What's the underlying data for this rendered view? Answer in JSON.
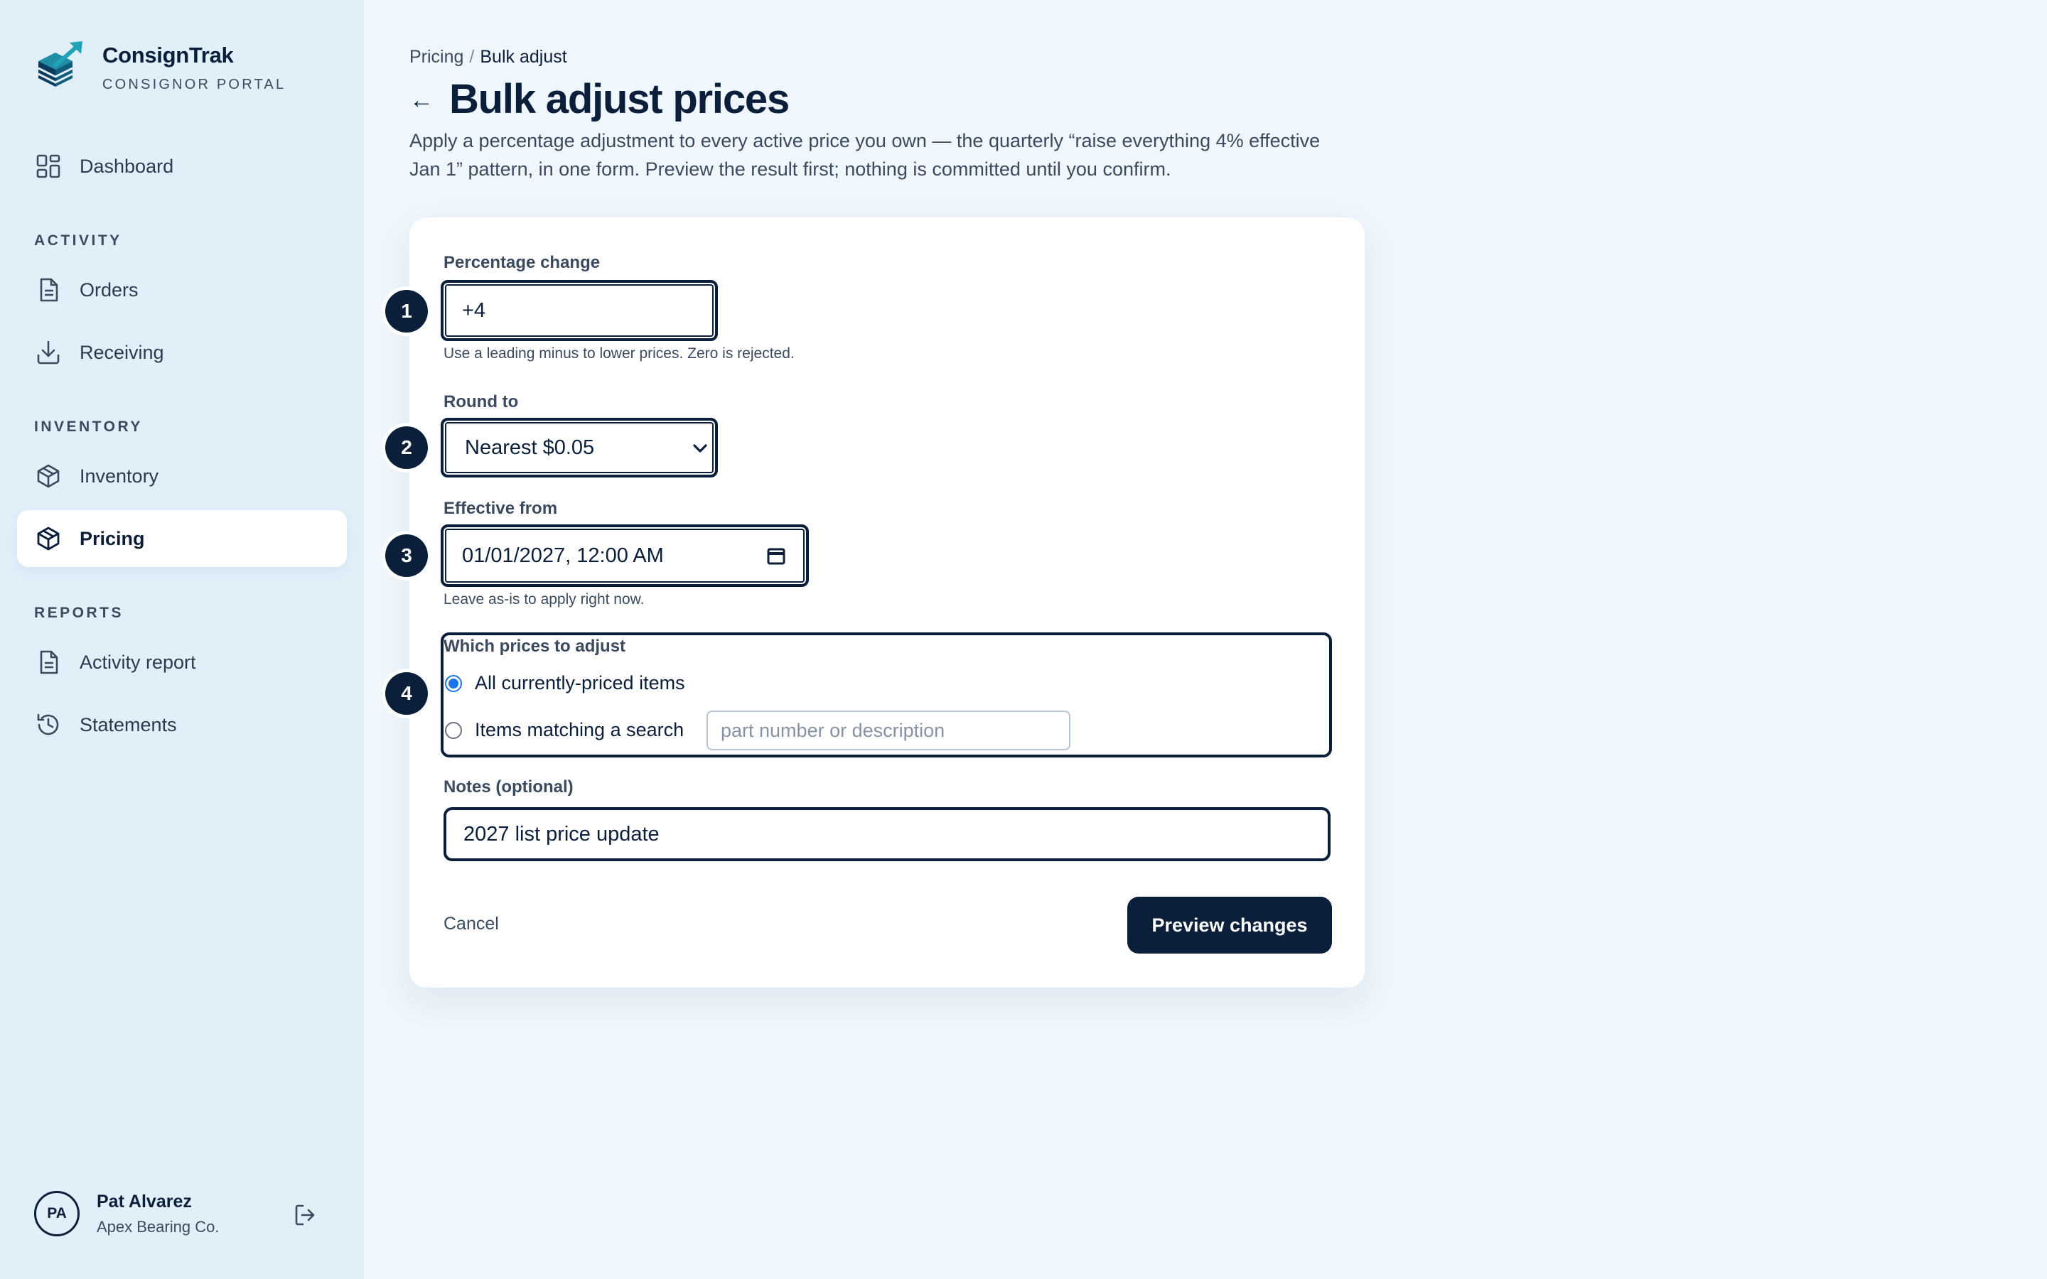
{
  "brand": {
    "name": "ConsignTrak",
    "subtitle": "CONSIGNOR PORTAL"
  },
  "sidebar": {
    "dashboard": "Dashboard",
    "sections": {
      "activity": "ACTIVITY",
      "inventory": "INVENTORY",
      "reports": "REPORTS"
    },
    "items": {
      "orders": "Orders",
      "receiving": "Receiving",
      "inventory": "Inventory",
      "pricing": "Pricing",
      "activity_report": "Activity report",
      "statements": "Statements"
    },
    "active": "Pricing"
  },
  "user": {
    "initials": "PA",
    "name": "Pat Alvarez",
    "org": "Apex Bearing Co."
  },
  "breadcrumb": {
    "parent": "Pricing",
    "separator": "/",
    "current": "Bulk adjust"
  },
  "page": {
    "title": "Bulk adjust prices",
    "lead": "Apply a percentage adjustment to every active price you own — the quarterly “raise everything 4% effective Jan 1” pattern, in one form. Preview the result first; nothing is committed until you confirm."
  },
  "form": {
    "percentage": {
      "step": "1",
      "label": "Percentage change",
      "value": "+4",
      "help": "Use a leading minus to lower prices. Zero is rejected."
    },
    "round": {
      "step": "2",
      "label": "Round to",
      "value": "Nearest $0.05"
    },
    "effective": {
      "step": "3",
      "label": "Effective from",
      "value": "01/01/2027, 12:00 AM",
      "help": "Leave as-is to apply right now."
    },
    "scope": {
      "step": "4",
      "label": "Which prices to adjust",
      "options": [
        {
          "label": "All currently-priced items",
          "checked": true
        },
        {
          "label": "Items matching a search",
          "checked": false
        }
      ],
      "search_placeholder": "part number or description"
    },
    "notes": {
      "label": "Notes (optional)",
      "value": "2027 list price update"
    },
    "cancel_label": "Cancel",
    "submit_label": "Preview changes"
  },
  "colors": {
    "navy": "#0b1f3a",
    "sidebar_bg": "#e1eff9",
    "page_bg": "#eff6fc",
    "radio_accent": "#1a73e8"
  }
}
